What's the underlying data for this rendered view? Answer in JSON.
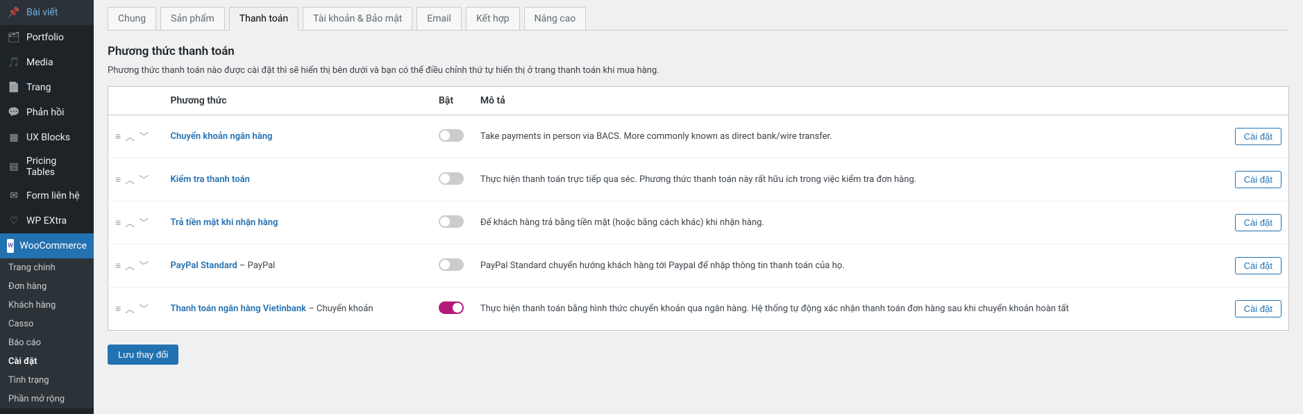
{
  "sidebar": {
    "items": [
      {
        "icon": "pin",
        "label": "Bài viết"
      },
      {
        "icon": "portfolio",
        "label": "Portfolio"
      },
      {
        "icon": "media",
        "label": "Media"
      },
      {
        "icon": "page",
        "label": "Trang"
      },
      {
        "icon": "comment",
        "label": "Phản hồi"
      },
      {
        "icon": "blocks",
        "label": "UX Blocks"
      },
      {
        "icon": "tables",
        "label": "Pricing Tables"
      },
      {
        "icon": "mail",
        "label": "Form liên hệ"
      },
      {
        "icon": "heart",
        "label": "WP EXtra"
      },
      {
        "icon": "woo",
        "label": "WooCommerce"
      }
    ],
    "submenu": [
      "Trang chính",
      "Đơn hàng",
      "Khách hàng",
      "Casso",
      "Báo cáo",
      "Cài đặt",
      "Tình trạng",
      "Phần mở rộng"
    ]
  },
  "tabs": [
    "Chung",
    "Sản phẩm",
    "Thanh toán",
    "Tài khoản & Bảo mật",
    "Email",
    "Kết hợp",
    "Nâng cao"
  ],
  "section_title": "Phương thức thanh toán",
  "section_desc": "Phương thức thanh toán nào được cài đặt thì sẽ hiển thị bên dưới và bạn có thể điều chỉnh thứ tự hiển thị ở trang thanh toán khi mua hàng.",
  "columns": {
    "method": "Phương thức",
    "enable": "Bật",
    "desc": "Mô tả"
  },
  "action_label": "Cài đặt",
  "rows": [
    {
      "name": "Chuyển khoản ngân hàng",
      "suffix": "",
      "enabled": false,
      "desc": "Take payments in person via BACS. More commonly known as direct bank/wire transfer."
    },
    {
      "name": "Kiểm tra thanh toán",
      "suffix": "",
      "enabled": false,
      "desc": "Thực hiện thanh toán trực tiếp qua séc. Phương thức thanh toán này rất hữu ích trong việc kiểm tra đơn hàng."
    },
    {
      "name": "Trả tiền mặt khi nhận hàng",
      "suffix": "",
      "enabled": false,
      "desc": "Để khách hàng trả bằng tiền mặt (hoặc bằng cách khác) khi nhận hàng."
    },
    {
      "name": "PayPal Standard",
      "suffix": " – PayPal",
      "enabled": false,
      "desc": "PayPal Standard chuyển hướng khách hàng tới Paypal để nhập thông tin thanh toán của họ."
    },
    {
      "name": "Thanh toán ngân hàng Vietinbank",
      "suffix": " – Chuyển khoản",
      "enabled": true,
      "desc": "Thực hiện thanh toán bằng hình thức chuyển khoản qua ngân hàng. Hệ thống tự động xác nhận thanh toán đơn hàng sau khi chuyển khoản hoàn tất"
    }
  ],
  "save_button": "Lưu thay đổi"
}
